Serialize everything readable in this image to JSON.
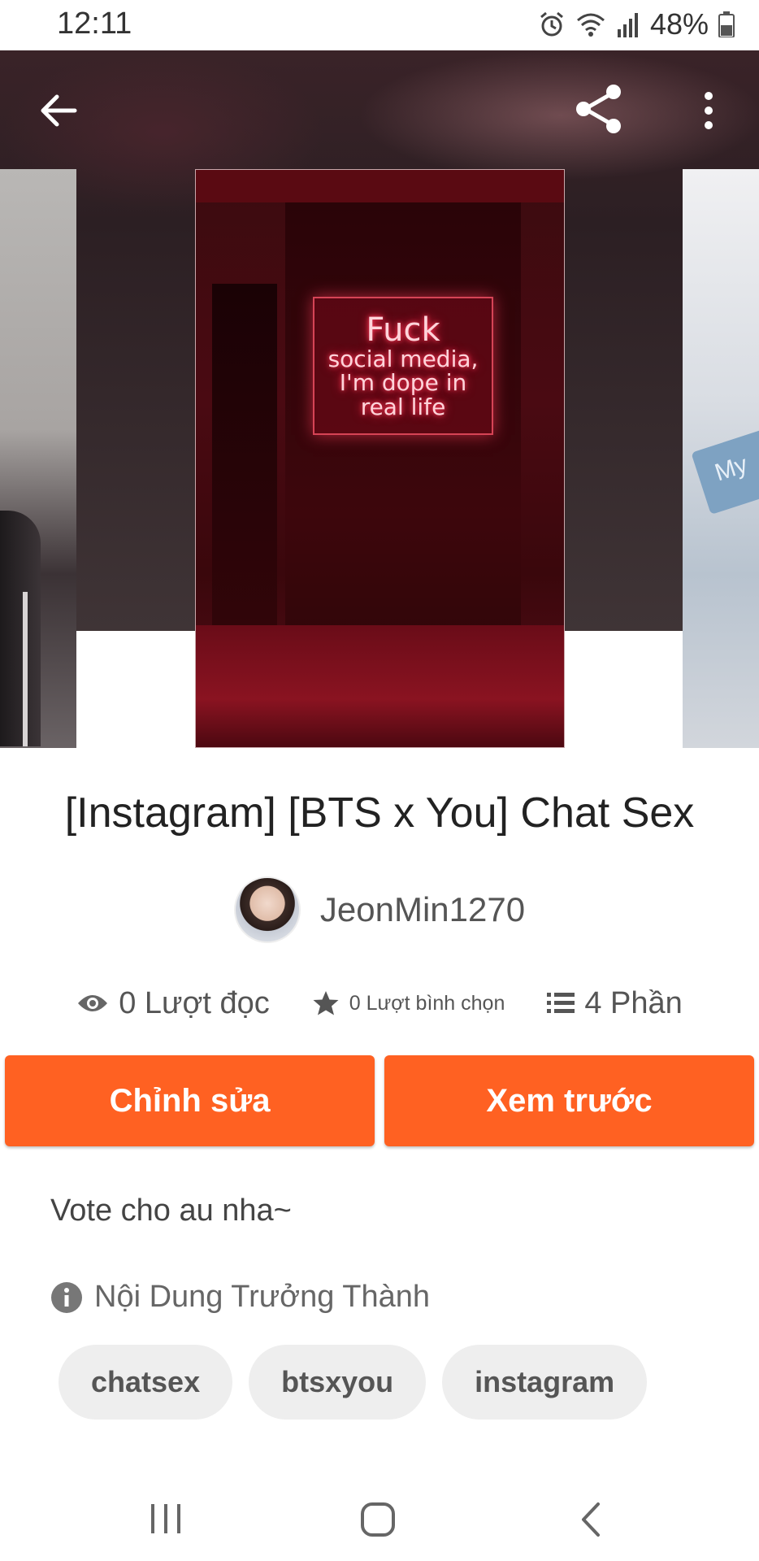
{
  "status_bar": {
    "time": "12:11",
    "battery": "48%",
    "icons": [
      "alarm-icon",
      "wifi-icon",
      "signal-icon",
      "battery-icon"
    ]
  },
  "top_bar": {
    "icons": [
      "back-arrow-icon",
      "share-icon",
      "more-vert-icon"
    ]
  },
  "cover": {
    "neon_lines": [
      "Fuck",
      "social media,",
      "I'm dope in",
      "real life"
    ],
    "side_cover_text": "My"
  },
  "story": {
    "title": "[Instagram] [BTS x You] Chat Sex",
    "author": "JeonMin1270",
    "reads": "0 Lượt đọc",
    "votes": "0 Lượt bình chọn",
    "parts": "4 Phần",
    "description": "Vote cho au nha~",
    "mature_label": "Nội Dung Trưởng Thành",
    "tags": [
      "chatsex",
      "btsxyou",
      "instagram"
    ]
  },
  "actions": {
    "edit_label": "Chỉnh sửa",
    "preview_label": "Xem trước"
  },
  "colors": {
    "accent": "#ff6122",
    "chip_bg": "#eeeeee"
  },
  "nav_bar": {
    "icons": [
      "recent-apps-icon",
      "home-icon",
      "back-icon"
    ]
  }
}
